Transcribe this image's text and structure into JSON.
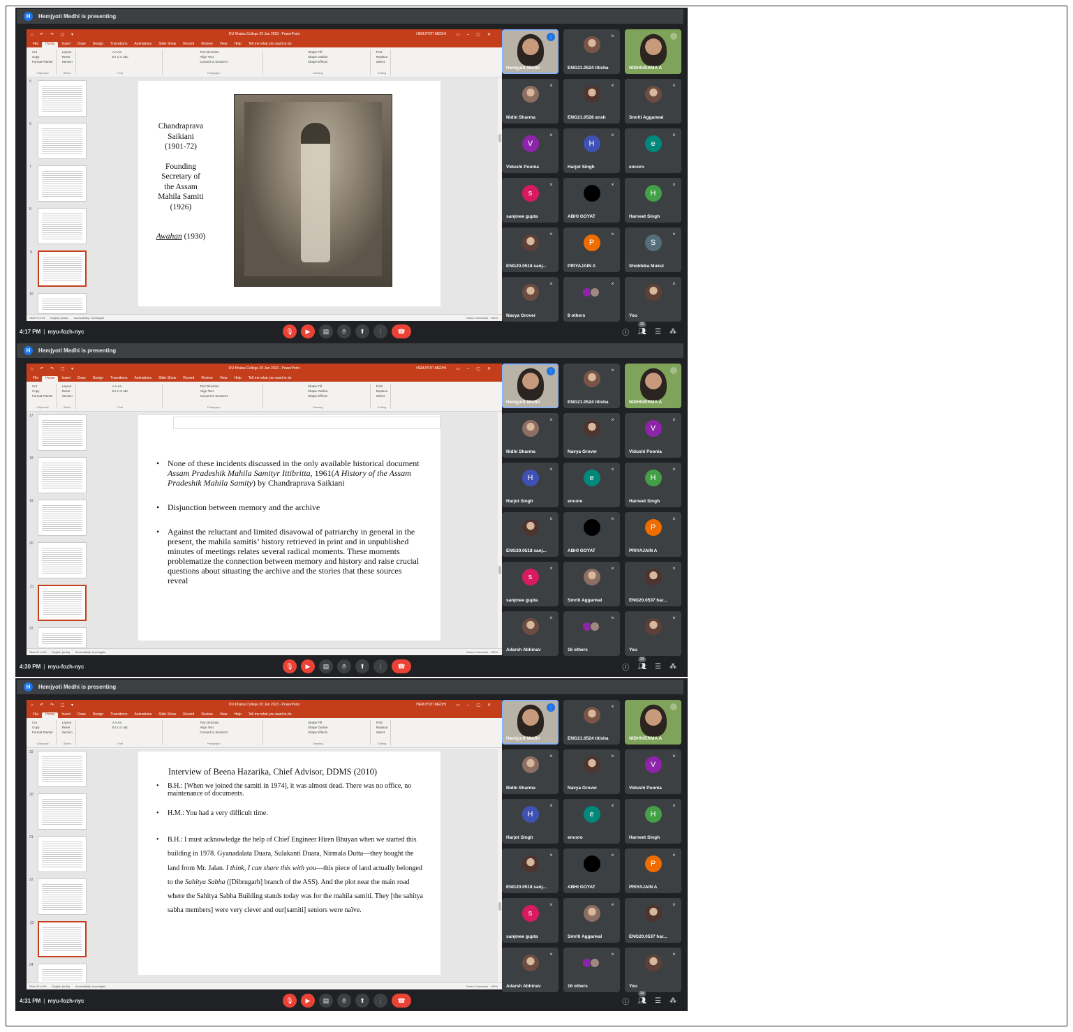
{
  "panels": [
    {
      "presenting": "Hemjyoti Medhi is presenting",
      "presenter_initial": "H",
      "ppt": {
        "doc_title": "DU Khalsa College 20 Jan 2023 - PowerPoint",
        "user": "HEMJYOTI MEDHI",
        "tabs": [
          "File",
          "Home",
          "Insert",
          "Draw",
          "Design",
          "Transitions",
          "Animations",
          "Slide Show",
          "Record",
          "Review",
          "View",
          "Help",
          "Tell me what you want to do"
        ],
        "ribbon_groups": [
          {
            "name": "Clipboard",
            "items": [
              "Cut",
              "Copy",
              "Paste",
              "Format Painter"
            ]
          },
          {
            "name": "Slides",
            "items": [
              "Layout",
              "Reset",
              "New Slide",
              "Section"
            ]
          },
          {
            "name": "Font",
            "items": [
              "B I U S abc",
              "A A Aa"
            ]
          },
          {
            "name": "Paragraph",
            "items": [
              "Text Direction",
              "Align Text",
              "Convert to SmartArt"
            ]
          },
          {
            "name": "Drawing",
            "items": [
              "Shape Fill",
              "Shape Outline",
              "Shape Effects",
              "Arrange",
              "Quick Styles"
            ]
          },
          {
            "name": "Editing",
            "items": [
              "Find",
              "Replace",
              "Select"
            ]
          }
        ],
        "thumb_numbers": [
          "5",
          "6",
          "7",
          "8",
          "9",
          "10"
        ],
        "status_left": "Slide 9 of 29",
        "status_lang": "English (India)",
        "status_access": "Accessibility: Investigate",
        "status_right": "Notes   Comments",
        "zoom": "106%"
      },
      "slide": {
        "left_lines": [
          "Chandraprava",
          "Saikiani",
          "(1901-72)",
          "",
          "Founding",
          "Secretary of",
          "the Assam",
          "Mahila Samiti",
          "(1926)",
          "",
          ""
        ],
        "awahan_italic": "Awahan",
        "awahan_rest": " (1930)"
      },
      "tiles": [
        {
          "name": "Hemjyoti Medhi",
          "type": "video",
          "speaking": true
        },
        {
          "name": "ENG21.0524 titisha",
          "type": "avatar-photo"
        },
        {
          "name": "NIDHIVERMA A",
          "type": "video"
        },
        {
          "name": "Nidhi Sharma",
          "type": "avatar-photo"
        },
        {
          "name": "ENG21.0528 ansh",
          "type": "avatar-photo"
        },
        {
          "name": "Smriti Aggarwal",
          "type": "avatar-photo"
        },
        {
          "name": "Vidushi Poonia",
          "type": "letter",
          "letter": "V",
          "color": "#8e24aa"
        },
        {
          "name": "Harjot Singh",
          "type": "letter",
          "letter": "H",
          "color": "#3f51b5"
        },
        {
          "name": "encoro",
          "type": "letter",
          "letter": "e",
          "color": "#00897b"
        },
        {
          "name": "sanjmee gupta",
          "type": "letter",
          "letter": "s",
          "color": "#d81b60"
        },
        {
          "name": "ABHI GOYAT",
          "type": "black"
        },
        {
          "name": "Harneet Singh",
          "type": "letter",
          "letter": "H",
          "color": "#43a047"
        },
        {
          "name": "ENG20.0518 sanj...",
          "type": "avatar-photo"
        },
        {
          "name": "PRIYAJAIN A",
          "type": "letter",
          "letter": "P",
          "color": "#ef6c00"
        },
        {
          "name": "Shobhika Mukul",
          "type": "letter",
          "letter": "S",
          "color": "#546e7a"
        },
        {
          "name": "Navya Grover",
          "type": "avatar-photo"
        },
        {
          "name": "8 others",
          "type": "others"
        },
        {
          "name": "You",
          "type": "avatar-photo"
        }
      ],
      "time": "4:17 PM",
      "meeting_code": "myu-fozh-nyc",
      "participant_count": "26"
    },
    {
      "presenting": "Hemjyoti Medhi is presenting",
      "presenter_initial": "H",
      "ppt": {
        "doc_title": "DU Khalsa College 20 Jan 2023 - PowerPoint",
        "user": "HEMJYOTI MEDHI",
        "tabs": [
          "File",
          "Home",
          "Insert",
          "Draw",
          "Design",
          "Transitions",
          "Animations",
          "Slide Show",
          "Record",
          "Review",
          "View",
          "Help",
          "Tell me what you want to do"
        ],
        "ribbon_groups": [
          {
            "name": "Clipboard",
            "items": [
              "Cut",
              "Copy",
              "Paste",
              "Format Painter"
            ]
          },
          {
            "name": "Slides",
            "items": [
              "Layout",
              "Reset",
              "New Slide",
              "Section"
            ]
          },
          {
            "name": "Font",
            "items": [
              "B I U S abc",
              "A A Aa"
            ]
          },
          {
            "name": "Paragraph",
            "items": [
              "Text Direction",
              "Align Text",
              "Convert to SmartArt"
            ]
          },
          {
            "name": "Drawing",
            "items": [
              "Shape Fill",
              "Shape Outline",
              "Shape Effects",
              "Arrange",
              "Quick Styles"
            ]
          },
          {
            "name": "Editing",
            "items": [
              "Find",
              "Replace",
              "Select"
            ]
          }
        ],
        "thumb_numbers": [
          "17",
          "18",
          "19",
          "20",
          "21",
          "22"
        ],
        "status_left": "Slide 21 of 29",
        "status_lang": "English (India)",
        "status_access": "Accessibility: Investigate",
        "status_right": "Notes   Comments",
        "zoom": "106%"
      },
      "slide": {
        "b1_pre": "None of these incidents discussed in the only available historical document ",
        "b1_it1": "Assam Pradeshik Mahila Samityr Ittibritta,",
        "b1_mid": " 1961(",
        "b1_it2": "A History of the Assam Pradeshik Mahila Samity",
        "b1_post": ") by Chandraprava Saikiani",
        "b2": "Disjunction between memory and the archive",
        "b3": "Against the reluctant and limited disavowal of patriarchy in general in the present, the mahila samitis’ history retrieved in print and in unpublished minutes of meetings relates several radical moments. These moments problematize the connection between memory and history and raise crucial questions about situating the archive and the stories that these sources reveal"
      },
      "tiles": [
        {
          "name": "Hemjyoti Medhi",
          "type": "video",
          "speaking": true
        },
        {
          "name": "ENG21.0524 titisha",
          "type": "avatar-photo"
        },
        {
          "name": "NIDHIVERMA A",
          "type": "video"
        },
        {
          "name": "Nidhi Sharma",
          "type": "avatar-photo"
        },
        {
          "name": "Navya Grover",
          "type": "avatar-photo"
        },
        {
          "name": "Vidushi Poonia",
          "type": "letter",
          "letter": "V",
          "color": "#8e24aa"
        },
        {
          "name": "Harjot Singh",
          "type": "letter",
          "letter": "H",
          "color": "#3f51b5"
        },
        {
          "name": "encore",
          "type": "letter",
          "letter": "e",
          "color": "#00897b"
        },
        {
          "name": "Harneet Singh",
          "type": "letter",
          "letter": "H",
          "color": "#43a047"
        },
        {
          "name": "ENG20.0518 sanj...",
          "type": "avatar-photo"
        },
        {
          "name": "ABHI GOYAT",
          "type": "black"
        },
        {
          "name": "PRIYAJAIN A",
          "type": "letter",
          "letter": "P",
          "color": "#ef6c00"
        },
        {
          "name": "sanjmee gupta",
          "type": "letter",
          "letter": "s",
          "color": "#d81b60"
        },
        {
          "name": "Smriti Aggarwal",
          "type": "avatar-photo"
        },
        {
          "name": "ENG20.0537 har...",
          "type": "avatar-photo"
        },
        {
          "name": "Adarsh Abhinav",
          "type": "avatar-photo"
        },
        {
          "name": "16 others",
          "type": "others"
        },
        {
          "name": "You",
          "type": "avatar-photo"
        }
      ],
      "time": "4:30 PM",
      "meeting_code": "myu-fozh-nyc",
      "participant_count": "33"
    },
    {
      "presenting": "Hemjyoti Medhi is presenting",
      "presenter_initial": "H",
      "ppt": {
        "doc_title": "DU Khalsa College 20 Jan 2023 - PowerPoint",
        "user": "HEMJYOTI MEDHI",
        "tabs": [
          "File",
          "Home",
          "Insert",
          "Draw",
          "Design",
          "Transitions",
          "Animations",
          "Slide Show",
          "Record",
          "Review",
          "View",
          "Help",
          "Tell me what you want to do"
        ],
        "ribbon_groups": [
          {
            "name": "Clipboard",
            "items": [
              "Cut",
              "Copy",
              "Paste",
              "Format Painter"
            ]
          },
          {
            "name": "Slides",
            "items": [
              "Layout",
              "Reset",
              "New Slide",
              "Section"
            ]
          },
          {
            "name": "Font",
            "items": [
              "B I U S abc",
              "A A Aa"
            ]
          },
          {
            "name": "Paragraph",
            "items": [
              "Text Direction",
              "Align Text",
              "Convert to SmartArt"
            ]
          },
          {
            "name": "Drawing",
            "items": [
              "Shape Fill",
              "Shape Outline",
              "Shape Effects",
              "Arrange",
              "Quick Styles"
            ]
          },
          {
            "name": "Editing",
            "items": [
              "Find",
              "Replace",
              "Select"
            ]
          }
        ],
        "thumb_numbers": [
          "19",
          "20",
          "21",
          "22",
          "23",
          "24"
        ],
        "status_left": "Slide 23 of 29",
        "status_lang": "English (India)",
        "status_access": "Accessibility: Investigate",
        "status_right": "Notes   Comments",
        "zoom": "106%"
      },
      "slide": {
        "heading": "Interview of Beena Hazarika, Chief Advisor, DDMS (2010)",
        "b1": "B.H.: [When we joined the samiti in 1974], it was almost dead. There was no office, no maintenance of documents.",
        "b2": "H.M.: You had a very difficult time.",
        "b3_a": "B.H.: I must acknowledge the help of Chief Engineer Hiren Bhuyan when we started this building in 1978. Gyanadalata Duara, Sulakanti Duara, Nirmala Dutta—they bought the land from Mr. Jalan. ",
        "b3_it1": "I think, I can share this with you",
        "b3_b": "—this piece of land actually belonged to the ",
        "b3_it2": "Sahitya Sabha",
        "b3_c": " ([Dibrugarh] branch of the ASS). And the plot near the main road where the Sahitya Sabha Building stands today was for the mahila samiti. They [the sahitya sabha members] were very clever and our[samiti] seniors were naïve."
      },
      "tiles": [
        {
          "name": "Hemjyoti Medhi",
          "type": "video",
          "speaking": true
        },
        {
          "name": "ENG21.0524 titisha",
          "type": "avatar-photo"
        },
        {
          "name": "NIDHIVERMA A",
          "type": "video"
        },
        {
          "name": "Nidhi Sharma",
          "type": "avatar-photo"
        },
        {
          "name": "Navya Grover",
          "type": "avatar-photo"
        },
        {
          "name": "Vidushi Poonia",
          "type": "letter",
          "letter": "V",
          "color": "#8e24aa"
        },
        {
          "name": "Harjot Singh",
          "type": "letter",
          "letter": "H",
          "color": "#3f51b5"
        },
        {
          "name": "encoro",
          "type": "letter",
          "letter": "e",
          "color": "#00897b"
        },
        {
          "name": "Harneet Singh",
          "type": "letter",
          "letter": "H",
          "color": "#43a047"
        },
        {
          "name": "ENG20.0518 sanj...",
          "type": "avatar-photo"
        },
        {
          "name": "ABHI GOYAT",
          "type": "black"
        },
        {
          "name": "PRIYAJAIN A",
          "type": "letter",
          "letter": "P",
          "color": "#ef6c00"
        },
        {
          "name": "sanjmee gupta",
          "type": "letter",
          "letter": "s",
          "color": "#d81b60"
        },
        {
          "name": "Smriti Aggarwal",
          "type": "avatar-photo"
        },
        {
          "name": "ENG20.0537 har...",
          "type": "avatar-photo"
        },
        {
          "name": "Adarsh Abhinav",
          "type": "avatar-photo"
        },
        {
          "name": "16 others",
          "type": "others"
        },
        {
          "name": "You",
          "type": "avatar-photo"
        }
      ],
      "time": "4:31 PM",
      "meeting_code": "myu-fozh-nyc",
      "participant_count": "34"
    }
  ],
  "icons": {
    "mic_off": "mic-off-icon",
    "cam_off": "camera-off-icon",
    "captions": "captions-icon",
    "hand": "raise-hand-icon",
    "present": "present-icon",
    "more": "more-vert-icon",
    "end": "end-call-icon",
    "info": "info-icon",
    "people": "people-icon",
    "chat": "chat-icon",
    "activities": "activities-icon"
  },
  "colors": {
    "meet_bg": "#202124",
    "ppt_accent": "#c43e1c",
    "end_call": "#ea4335",
    "speaking": "#8ab4f8"
  }
}
